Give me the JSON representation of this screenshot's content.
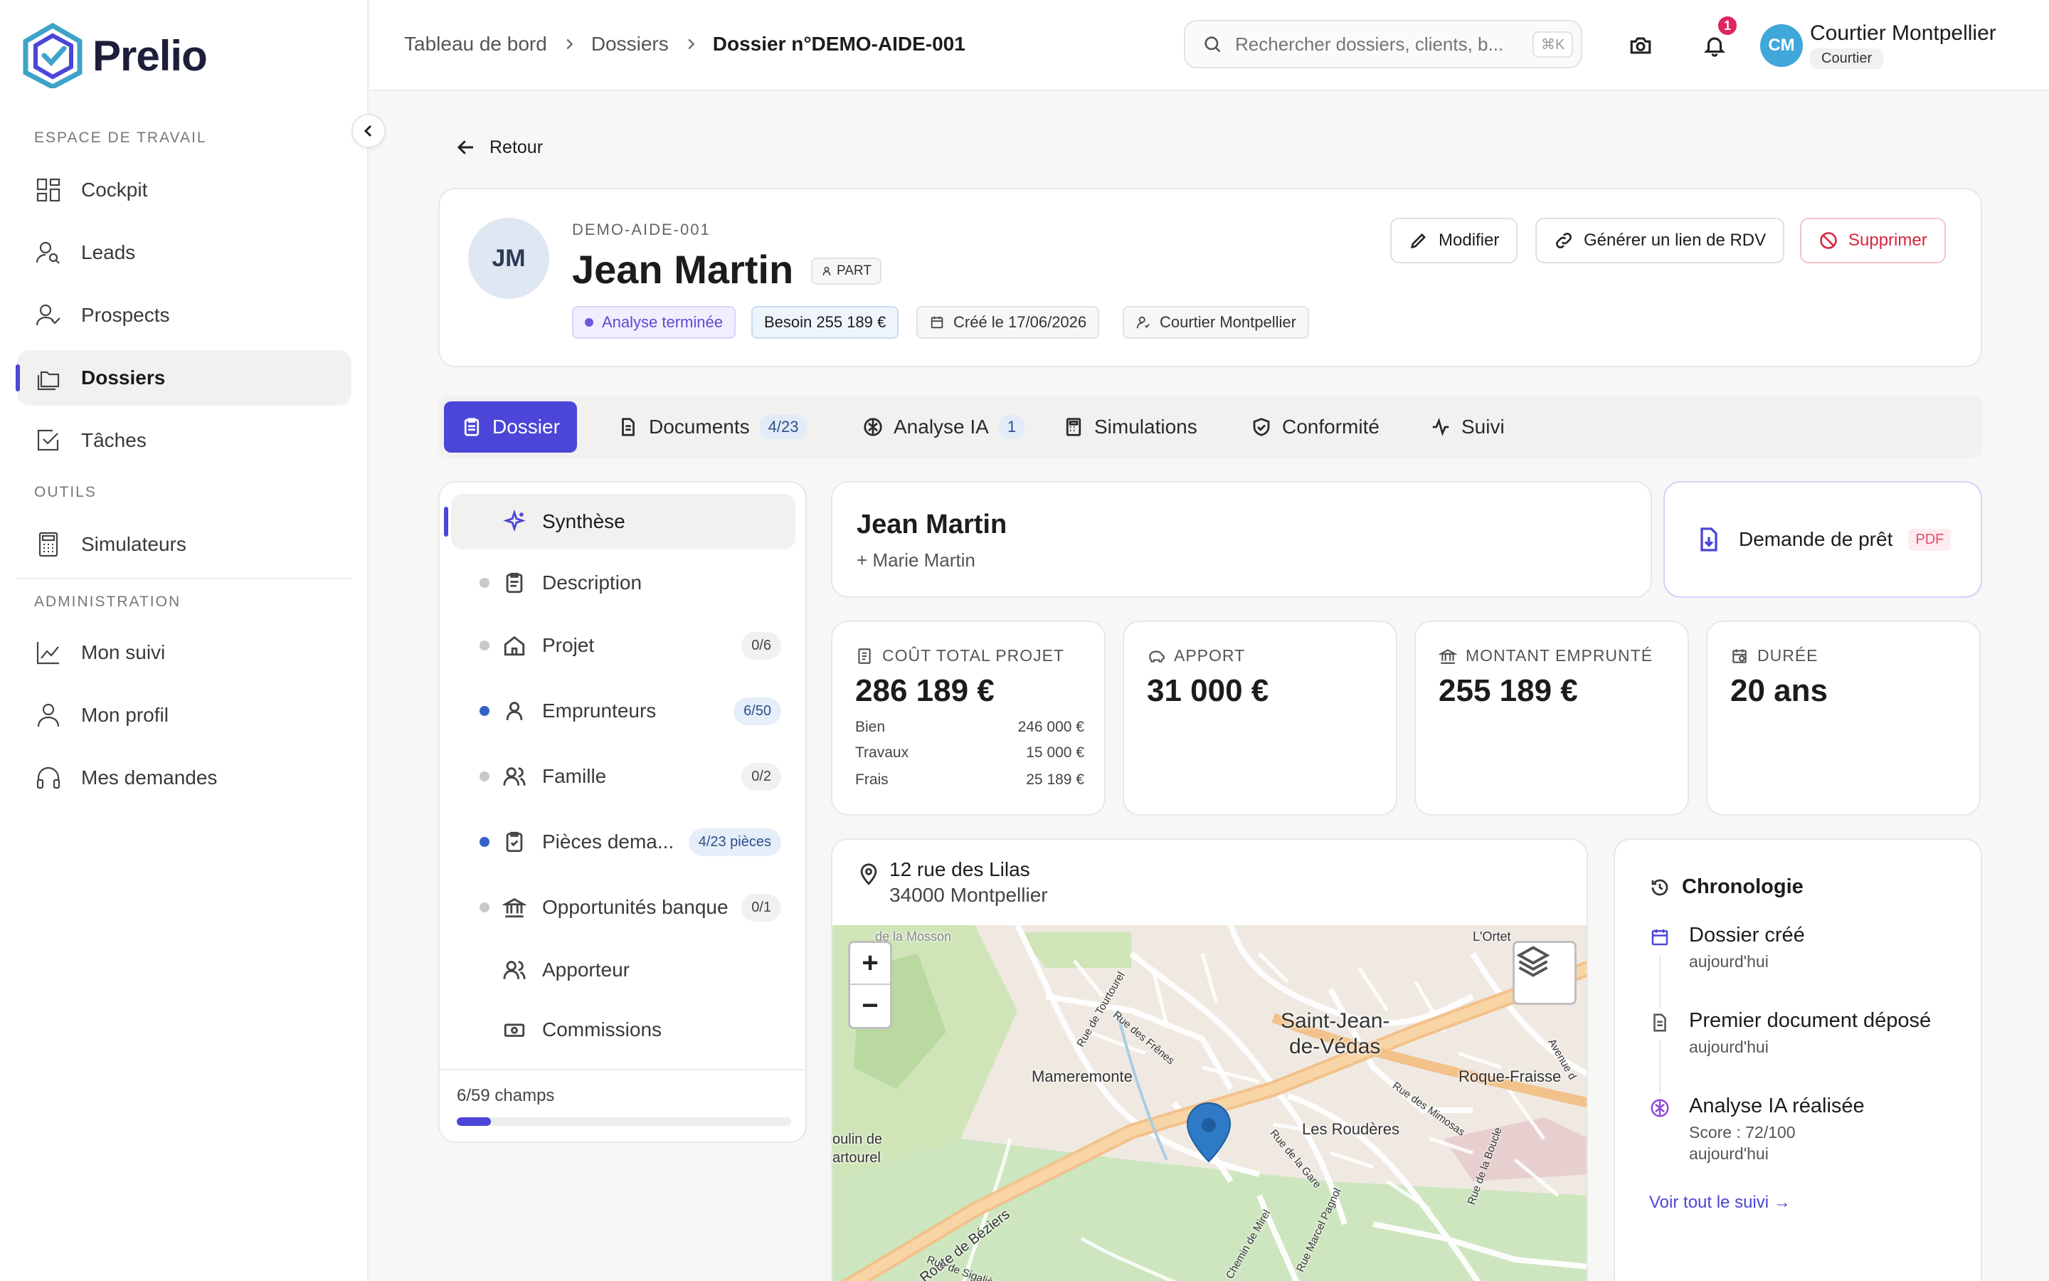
{
  "brand": {
    "name": "Prelio",
    "accent": "#4b46d8"
  },
  "sidebar": {
    "section_workspace": "ESPACE DE TRAVAIL",
    "section_tools": "OUTILS",
    "section_admin": "ADMINISTRATION",
    "items": [
      {
        "label": "Cockpit",
        "icon": "grid-icon"
      },
      {
        "label": "Leads",
        "icon": "user-search-icon"
      },
      {
        "label": "Prospects",
        "icon": "user-check-icon"
      },
      {
        "label": "Dossiers",
        "icon": "folders-icon",
        "active": true
      },
      {
        "label": "Tâches",
        "icon": "checkbox-icon"
      },
      {
        "label": "Simulateurs",
        "icon": "calculator-icon"
      },
      {
        "label": "Mon suivi",
        "icon": "chart-line-icon"
      },
      {
        "label": "Mon profil",
        "icon": "user-icon"
      },
      {
        "label": "Mes demandes",
        "icon": "headset-icon"
      }
    ]
  },
  "header": {
    "breadcrumb": [
      "Tableau de bord",
      "Dossiers",
      "Dossier n°DEMO-AIDE-001"
    ],
    "search_placeholder": "Rechercher dossiers, clients, b...",
    "search_shortcut": "⌘K",
    "notifications": "1",
    "user_initials": "CM",
    "user_name": "Courtier Montpellier",
    "user_role": "Courtier"
  },
  "back_label": "Retour",
  "profile": {
    "initials": "JM",
    "reference": "DEMO-AIDE-001",
    "name": "Jean Martin",
    "type_badge": "PART",
    "status": "Analyse terminée",
    "need": "Besoin 255 189 €",
    "created": "Créé le 17/06/2026",
    "owner": "Courtier Montpellier",
    "actions": {
      "edit": "Modifier",
      "link": "Générer un lien de RDV",
      "delete": "Supprimer"
    }
  },
  "tabs": [
    {
      "label": "Dossier",
      "count": ""
    },
    {
      "label": "Documents",
      "count": "4/23"
    },
    {
      "label": "Analyse IA",
      "count": "1"
    },
    {
      "label": "Simulations",
      "count": ""
    },
    {
      "label": "Conformité",
      "count": ""
    },
    {
      "label": "Suivi",
      "count": ""
    }
  ],
  "sections": [
    {
      "label": "Synthèse",
      "count": ""
    },
    {
      "label": "Description",
      "count": ""
    },
    {
      "label": "Projet",
      "count": "0/6"
    },
    {
      "label": "Emprunteurs",
      "count": "6/50"
    },
    {
      "label": "Famille",
      "count": "0/2"
    },
    {
      "label": "Pièces dema...",
      "count": "4/23 pièces"
    },
    {
      "label": "Opportunités banque",
      "count": "0/1"
    },
    {
      "label": "Apporteur",
      "count": ""
    },
    {
      "label": "Commissions",
      "count": ""
    }
  ],
  "fields_progress": {
    "label": "6/59 champs",
    "value": 0.1017
  },
  "borrower": {
    "name": "Jean Martin",
    "co": "+ Marie Martin"
  },
  "pdf_card": {
    "label": "Demande de prêt",
    "tag": "PDF"
  },
  "kpis": {
    "total": {
      "label": "COÛT TOTAL PROJET",
      "value": "286 189 €",
      "rows": [
        {
          "k": "Bien",
          "v": "246 000 €"
        },
        {
          "k": "Travaux",
          "v": "15 000 €"
        },
        {
          "k": "Frais",
          "v": "25 189 €"
        }
      ]
    },
    "apport": {
      "label": "APPORT",
      "value": "31 000 €"
    },
    "loan": {
      "label": "MONTANT EMPRUNTÉ",
      "value": "255 189 €"
    },
    "duration": {
      "label": "DURÉE",
      "value": "20 ans"
    }
  },
  "address": {
    "line1": "12 rue des Lilas",
    "line2": "34000 Montpellier"
  },
  "map_labels": {
    "city": "Saint-Jean-",
    "city2": "de-Védas",
    "a": "Mameremonte",
    "b": "Roque-Fraisse",
    "c": "Les Roudères",
    "d": "Route de Béziers",
    "e": "L'Ortet",
    "f": "Rue de Tourtourel",
    "g": "de la Mosson",
    "h": "oulin de",
    "i": "artourel",
    "j": "Rue des Frênes",
    "k": "Rue des Mimosas",
    "l": "Rue de la Gare",
    "m": "Chemin de Mirel",
    "n": "Rue Marcel Pagnol",
    "o": "Avenue d",
    "p": "Rue de Sigalière",
    "q": "Rue de la Boucle"
  },
  "timeline": {
    "title": "Chronologie",
    "items": [
      {
        "title": "Dossier créé",
        "sub": "aujourd'hui",
        "sub2": ""
      },
      {
        "title": "Premier document déposé",
        "sub": "aujourd'hui",
        "sub2": ""
      },
      {
        "title": "Analyse IA réalisée",
        "sub": "Score : 72/100",
        "sub2": "aujourd'hui"
      }
    ],
    "see_all": "Voir tout le suivi →"
  }
}
